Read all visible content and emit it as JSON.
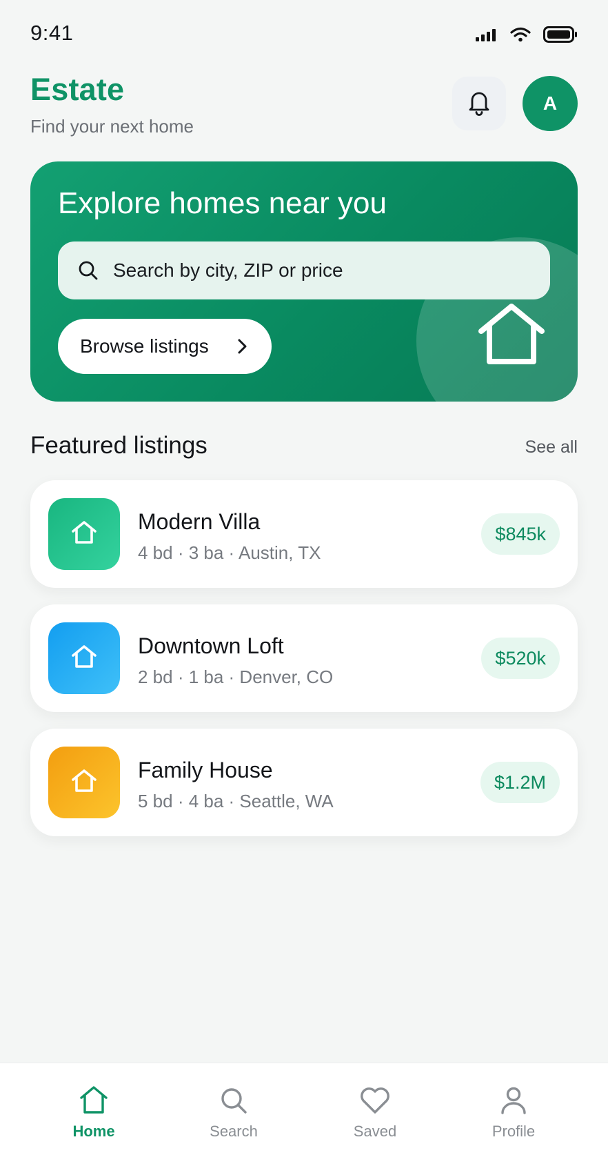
{
  "status_bar": {
    "time": "9:41"
  },
  "header": {
    "title": "Estate",
    "subtitle": "Find your next home",
    "avatar_initial": "A"
  },
  "hero": {
    "title": "Explore homes near you",
    "search_placeholder": "Search by city, ZIP or price",
    "browse_label": "Browse listings"
  },
  "featured": {
    "title": "Featured listings",
    "see_all": "See all"
  },
  "listings": [
    {
      "title": "Modern Villa",
      "meta": "4 bd · 3 ba · Austin, TX",
      "price": "$845k",
      "color": "#22c18a"
    },
    {
      "title": "Downtown Loft",
      "meta": "2 bd · 1 ba · Denver, CO",
      "price": "$520k",
      "color": "#1aa6f0"
    },
    {
      "title": "Family House",
      "meta": "5 bd · 4 ba · Seattle, WA",
      "price": "$1.2M",
      "color": "#f5a416"
    }
  ],
  "nav": [
    {
      "label": "Home",
      "icon": "home-icon",
      "active": true
    },
    {
      "label": "Search",
      "icon": "search-icon",
      "active": false
    },
    {
      "label": "Saved",
      "icon": "heart-icon",
      "active": false
    },
    {
      "label": "Profile",
      "icon": "user-icon",
      "active": false
    }
  ],
  "colors": {
    "brand": "#0f9366",
    "background": "#f4f6f5"
  }
}
